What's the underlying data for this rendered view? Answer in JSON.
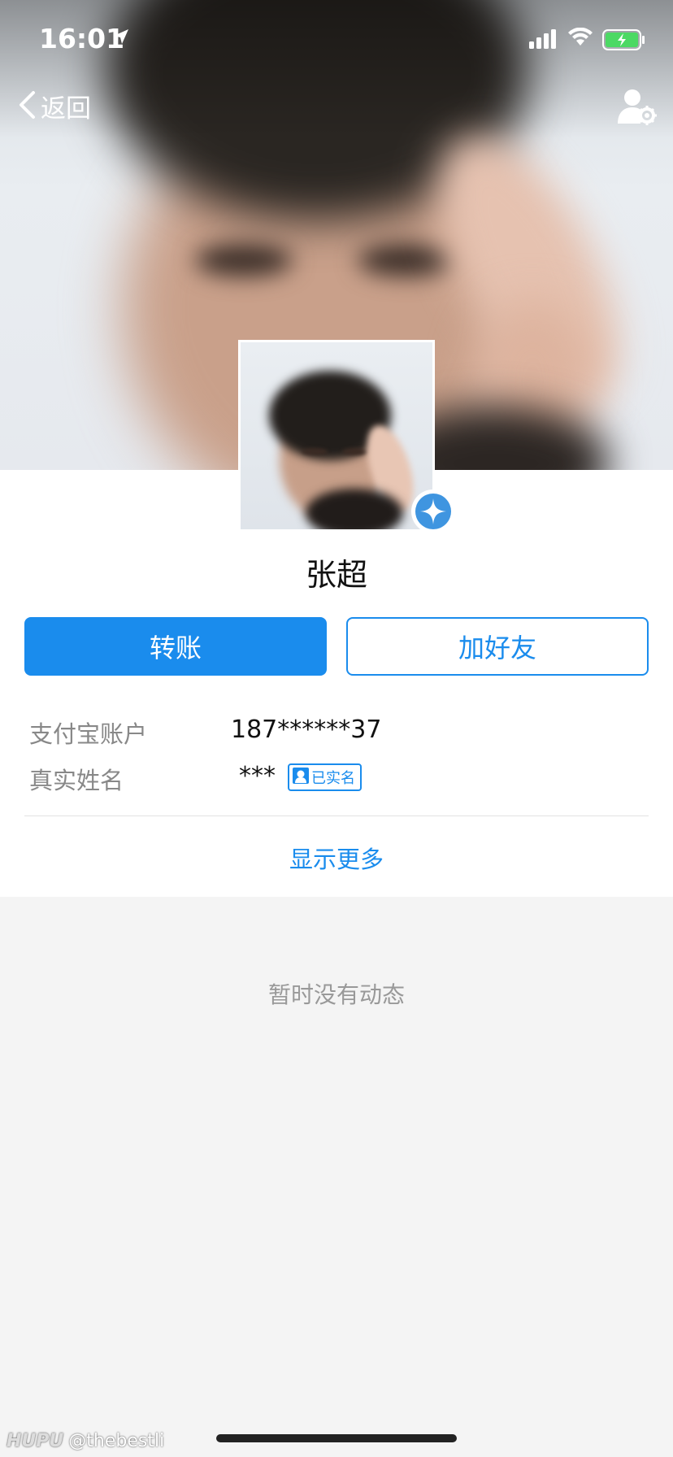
{
  "status_bar": {
    "time": "16:01",
    "icons": [
      "location-arrow-icon",
      "signal-icon",
      "wifi-icon",
      "battery-charging-icon"
    ]
  },
  "nav": {
    "back_label": "返回",
    "right_icon": "user-settings-icon"
  },
  "profile": {
    "name": "张超",
    "badge_icon": "star-badge-icon"
  },
  "actions": {
    "transfer_label": "转账",
    "add_friend_label": "加好友"
  },
  "info": {
    "account_label": "支付宝账户",
    "account_value": "187******37",
    "realname_label": "真实姓名",
    "realname_value": "***",
    "verified_label": "已实名"
  },
  "show_more_label": "显示更多",
  "empty_feed_text": "暂时没有动态",
  "watermark": {
    "brand": "HUPU",
    "handle": "@thebestli"
  },
  "colors": {
    "accent": "#1a8ced",
    "background": "#f4f4f4",
    "muted_text": "#999999"
  }
}
